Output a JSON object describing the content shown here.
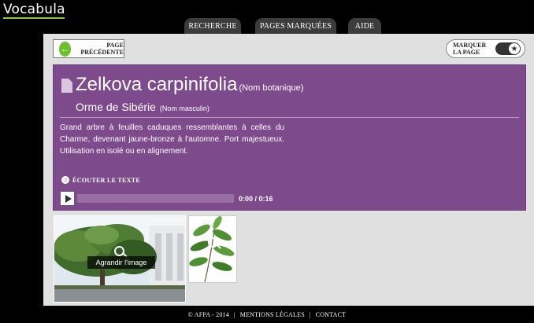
{
  "header": {
    "logo": "Vocabula",
    "tabs": [
      "Recherche",
      "Pages marquées",
      "Aide"
    ]
  },
  "nav": {
    "prev_label_line1": "Page",
    "prev_label_line2": "précédente",
    "mark_label_line1": "Marquer",
    "mark_label_line2": "la page",
    "mark_icon": "star-icon",
    "prev_icon": "arrow-left-icon"
  },
  "entry": {
    "scientific_name": "Zelkova carpinifolia",
    "scientific_type": "(Nom botanique)",
    "common_name": "Orme de Sibérie",
    "common_type": "(Nom masculin)",
    "description": "Grand arbre à feuilles caduques ressemblantes à celles du Charme, devenant jaune-bronze à l'automne. Port majestueux. Utilisation en isolé ou en alignement.",
    "listen_label": "Écouter le texte",
    "time_display": "0:00 / 0:16",
    "progress": 0
  },
  "gallery": {
    "enlarge_label": "Agrandir l'image"
  },
  "footer": {
    "copyright": "© AFPA - 2014",
    "sep": "|",
    "legal": "Mentions légales",
    "contact": "Contact"
  },
  "colors": {
    "panel": "#7d4a8b",
    "accent_green": "#6cbf2d",
    "logo_underline": "#8dc63f"
  }
}
